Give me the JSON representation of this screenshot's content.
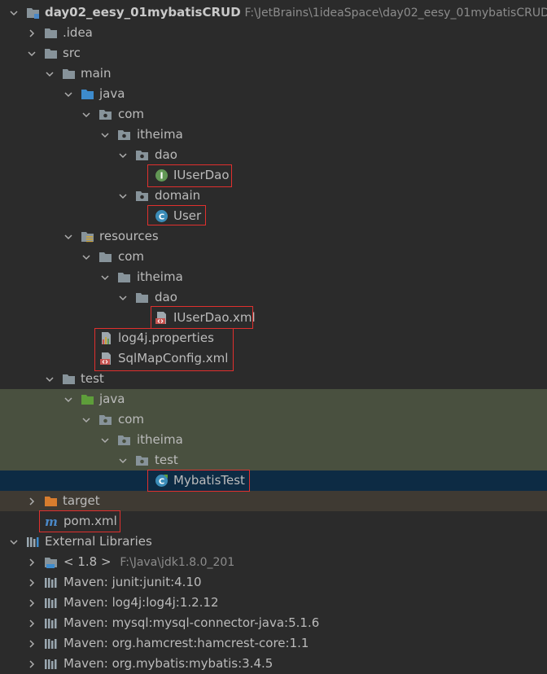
{
  "project": {
    "name": "day02_eesy_01mybatisCRUD",
    "path": "F:\\JetBrains\\1ideaSpace\\day02_eesy_01mybatisCRUD"
  },
  "tree": {
    "idea": ".idea",
    "src": "src",
    "main": "main",
    "java": "java",
    "com": "com",
    "itheima": "itheima",
    "dao": "dao",
    "iuserdao": "IUserDao",
    "domain": "domain",
    "user": "User",
    "resources": "resources",
    "res_com": "com",
    "res_itheima": "itheima",
    "res_dao": "dao",
    "iuserdao_xml": "IUserDao.xml",
    "log4j": "log4j.properties",
    "sqlmapconfig": "SqlMapConfig.xml",
    "test": "test",
    "test_java": "java",
    "test_com": "com",
    "test_itheima": "itheima",
    "test_pkg": "test",
    "mybatistest": "MybatisTest",
    "target": "target",
    "pom": "pom.xml",
    "external_libraries": "External Libraries",
    "jdk": "< 1.8 >",
    "jdk_path": "F:\\Java\\jdk1.8.0_201",
    "lib_junit": "Maven: junit:junit:4.10",
    "lib_log4j": "Maven: log4j:log4j:1.2.12",
    "lib_mysql": "Maven: mysql:mysql-connector-java:5.1.6",
    "lib_hamcrest": "Maven: org.hamcrest:hamcrest-core:1.1",
    "lib_mybatis": "Maven: org.mybatis:mybatis:3.4.5"
  },
  "colors": {
    "background": "#2b2b2b",
    "selection": "#0d2b44",
    "test_root_highlight": "#49503f",
    "excluded_highlight": "#3f3a33",
    "annotation_box": "#e0302e"
  },
  "icons": {
    "folder": "folder-icon",
    "source_folder": "source-folder-icon",
    "test_folder": "test-source-folder-icon",
    "resources_folder": "resources-folder-icon",
    "package": "package-icon",
    "interface": "interface-icon",
    "class": "class-icon",
    "test_class": "test-class-icon",
    "xml": "xml-file-icon",
    "properties": "properties-file-icon",
    "maven": "maven-icon",
    "library": "library-icon",
    "jdk": "jdk-icon"
  }
}
